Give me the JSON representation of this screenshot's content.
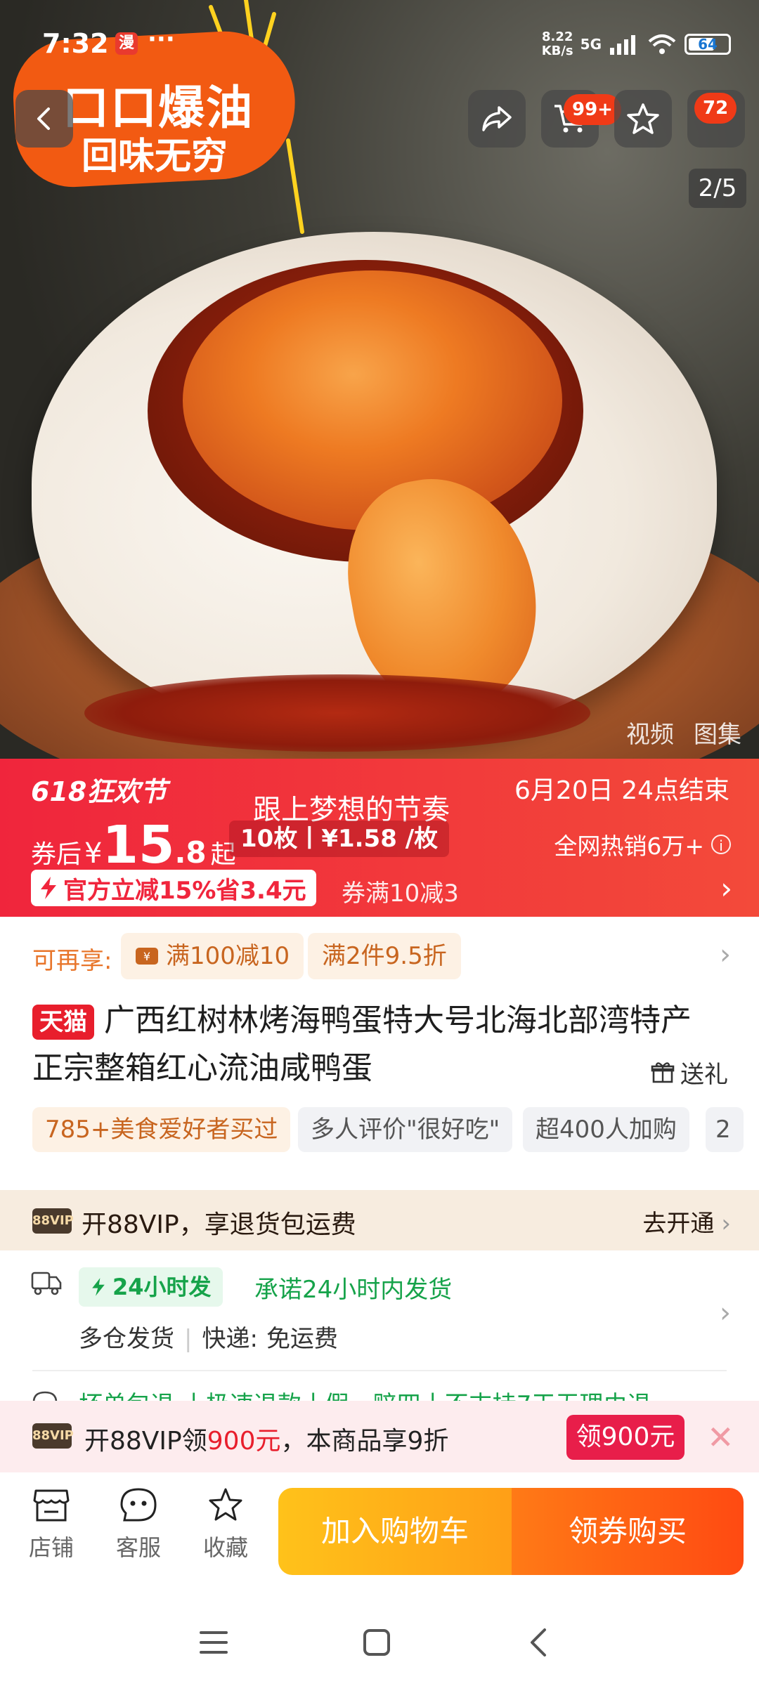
{
  "status_bar": {
    "time": "7:32",
    "app_icon_text": "漫",
    "more_dots": "···",
    "net_speed_value": "8.22",
    "net_speed_unit": "KB/s",
    "network": "5G",
    "battery": "64"
  },
  "hero": {
    "promo_line1": "口口爆油",
    "promo_line2": "回味无穷",
    "cart_badge": "99+",
    "more_badge": "72",
    "page_indicator": "2/5",
    "media_tabs": [
      "视频",
      "图集"
    ]
  },
  "promo_banner": {
    "festival": "618狂欢节",
    "slogan": "跟上梦想的节奏",
    "end_time": "6月20日 24点结束",
    "price_prefix": "券后",
    "currency": "¥",
    "price_int": "15",
    "price_dec": ".8",
    "price_suffix": "起",
    "unit_price": "10枚丨¥1.58 /枚",
    "hot_sales": "全网热销6万+",
    "official_discount": "官方立减15%省3.4元",
    "coupon_rule": "券满10减3"
  },
  "offers": {
    "label": "可再享:",
    "tags": [
      "满100减10",
      "满2件9.5折"
    ]
  },
  "product": {
    "store_badge": "天猫",
    "title_line1": "广西红树林烤海鸭蛋特大号北海北部湾特产",
    "title_line2": "正宗整箱红心流油咸鸭蛋",
    "gift_label": "送礼",
    "chips": [
      "785+美食爱好者买过",
      "多人评价\"很好吃\"",
      "超400人加购",
      "2"
    ]
  },
  "vip_strip": {
    "icon_text": "88VIP",
    "text": "开88VIP，享退货包运费",
    "action": "去开通"
  },
  "shipping": {
    "tag": "24小时发",
    "promise": "承诺24小时内发货",
    "warehouse": "多仓发货",
    "express_label": "快递:",
    "express_value": "免运费",
    "partial": "坏单包退 丨极速退款丨假一赔四丨不支持7天无理由退"
  },
  "vip_popup": {
    "icon_text": "88VIP",
    "text_before": "开88VIP领",
    "amount": "900元",
    "text_after": "，本商品享9折",
    "button": "领900元",
    "close": "✕"
  },
  "action_bar": {
    "shop": "店铺",
    "service": "客服",
    "favorite": "收藏",
    "add_to_cart": "加入购物车",
    "buy_with_coupon": "领券购买"
  },
  "colors": {
    "banner_red": "#f0253c",
    "tmall_red": "#e81e2c",
    "cart_yellow": "#ffc21a",
    "buy_orange": "#ff4a12",
    "ship_green": "#16a34a"
  }
}
